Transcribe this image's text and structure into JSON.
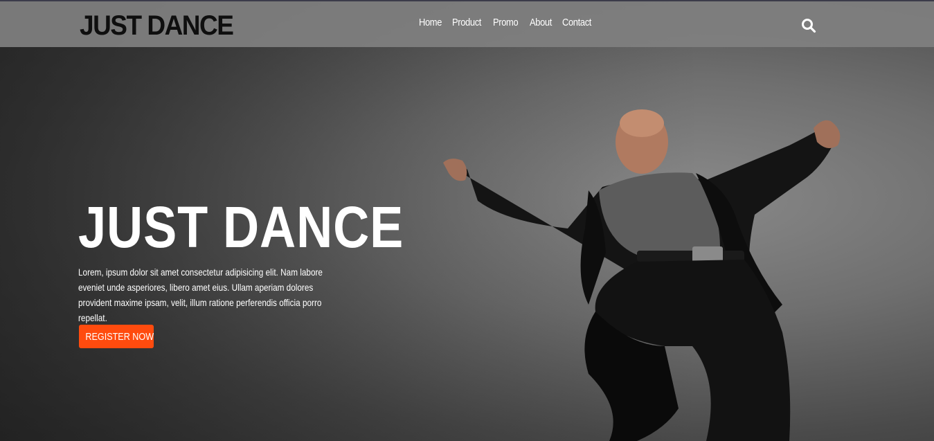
{
  "brand": {
    "logo_text": "JUST DANCE"
  },
  "nav": {
    "items": [
      {
        "label": "Home"
      },
      {
        "label": "Product"
      },
      {
        "label": "Promo"
      },
      {
        "label": "About"
      },
      {
        "label": "Contact"
      }
    ]
  },
  "hero": {
    "title": "JUST DANCE",
    "text": "Lorem, ipsum dolor sit amet consectetur adipisicing elit. Nam labore eveniet unde asperiores, libero amet eius. Ullam aperiam dolores provident maxime ipsam, velit, illum ratione perferendis officia porro repellat.",
    "button_label": "REGISTER NOW",
    "image": "dancer-photo"
  },
  "icons": {
    "search": "search-icon"
  },
  "colors": {
    "accent": "#ff4b0e",
    "navbar": "#808080",
    "text": "#ffffff",
    "logo": "#0f0f0f"
  }
}
